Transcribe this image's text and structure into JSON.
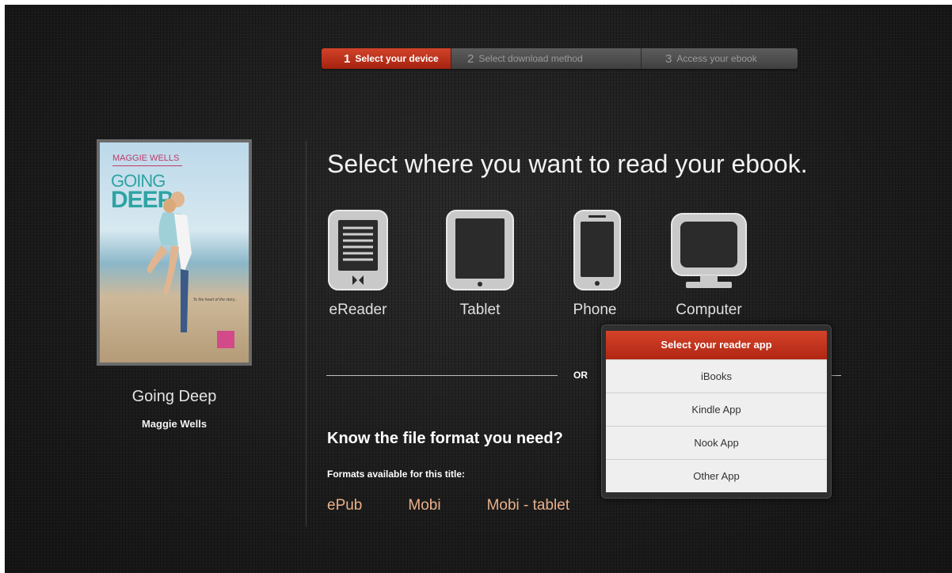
{
  "steps": [
    {
      "num": "1",
      "label": "Select your device"
    },
    {
      "num": "2",
      "label": "Select download method"
    },
    {
      "num": "3",
      "label": "Access your ebook"
    }
  ],
  "book": {
    "cover_author": "MAGGIE WELLS",
    "cover_title_line1": "GOING",
    "cover_title_line2": "DEEP",
    "cover_tagline": "To the heart of the story...",
    "title": "Going Deep",
    "author": "Maggie Wells"
  },
  "headline": "Select where you want to read your ebook.",
  "devices": [
    {
      "label": "eReader",
      "icon": "ereader-icon"
    },
    {
      "label": "Tablet",
      "icon": "tablet-icon"
    },
    {
      "label": "Phone",
      "icon": "phone-icon"
    },
    {
      "label": "Computer",
      "icon": "computer-icon"
    }
  ],
  "or_label": "OR",
  "format_section": {
    "heading": "Know the file format you need?",
    "subheading": "Formats available for this title:",
    "formats": [
      "ePub",
      "Mobi",
      "Mobi - tablet"
    ]
  },
  "reader_dropdown": {
    "header": "Select your reader app",
    "items": [
      "iBooks",
      "Kindle App",
      "Nook App",
      "Other App"
    ]
  },
  "colors": {
    "accent_red": "#c5321b",
    "format_link": "#e9b089",
    "background": "#1e1e1e"
  }
}
